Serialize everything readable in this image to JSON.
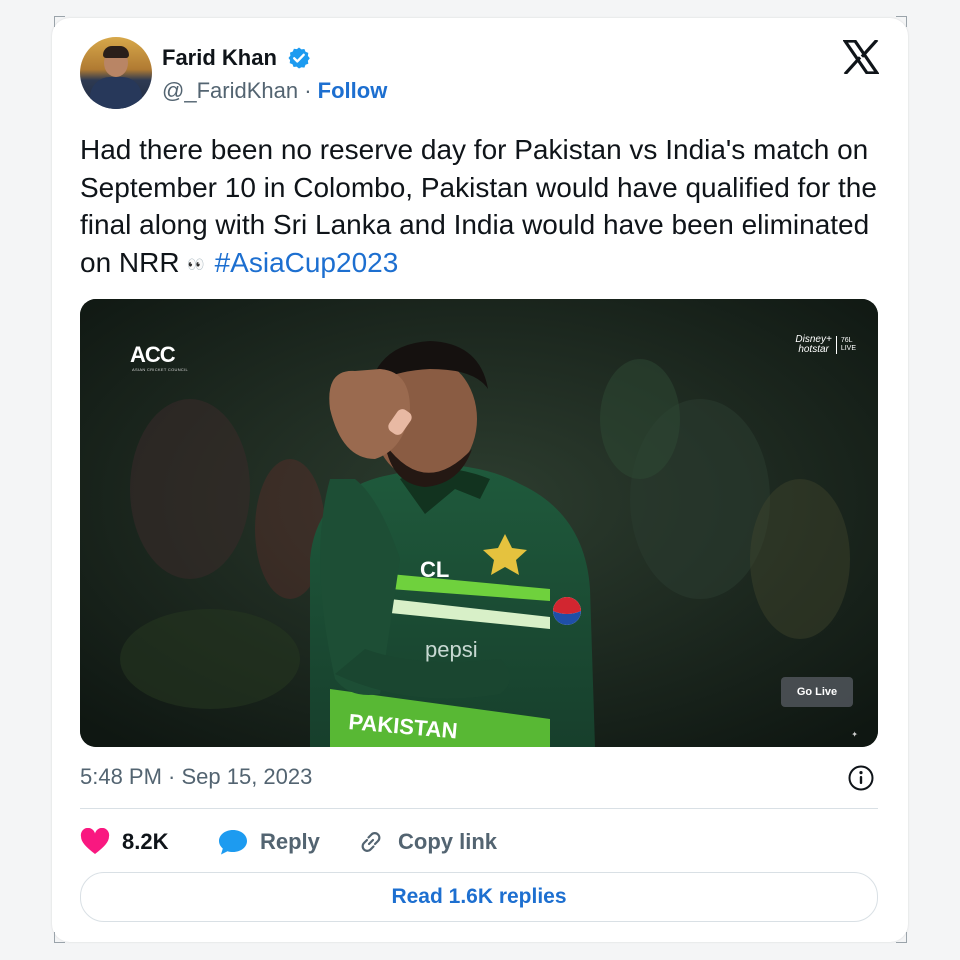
{
  "author": {
    "name": "Farid Khan",
    "handle": "@_FaridKhan",
    "separator": "·",
    "follow_label": "Follow",
    "verified_icon": "verified-badge-icon",
    "verified_color": "#1d9bf0"
  },
  "platform_logo": "x-logo-icon",
  "tweet": {
    "text_main": "Had there been no reserve day for Pakistan vs India's match on September 10 in Colombo, Pakistan would have qualified for the final along with Sri Lanka and India would have been eliminated on NRR ",
    "emoji": "👀",
    "hashtag": "#AsiaCup2023",
    "hashtag_color": "#1d6fd0"
  },
  "media": {
    "overlay_logo": "ACC",
    "overlay_logo_sub": "ASIAN CRICKET COUNCIL",
    "broadcaster_brand_top": "Disney+",
    "broadcaster_brand_bottom": "hotstar",
    "viewers": "76L",
    "live_label": "LIVE",
    "go_live_label": "Go Live",
    "jersey_text_sponsor": "pepsi",
    "jersey_text_country": "PAKISTAN"
  },
  "timestamp": "5:48 PM · Sep 15, 2023",
  "info_icon": "info-icon",
  "actions": {
    "likes_count": "8.2K",
    "like_icon": "heart-icon",
    "like_color": "#f91880",
    "reply_label": "Reply",
    "reply_icon": "reply-bubble-icon",
    "reply_color": "#1d9bf0",
    "copy_label": "Copy link",
    "copy_icon": "link-icon"
  },
  "read_replies_label": "Read 1.6K replies"
}
